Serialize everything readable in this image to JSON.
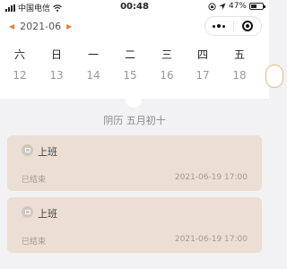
{
  "status_bar": {
    "carrier": "中国电信",
    "time": "00:48",
    "battery_percent": "47%",
    "battery_level": 0.47
  },
  "header": {
    "month": "2021-06",
    "prev_arrow": "◀",
    "next_arrow": "▶"
  },
  "calendar": {
    "weekdays": [
      "六",
      "日",
      "一",
      "二",
      "三",
      "四",
      "五"
    ],
    "days": [
      "12",
      "13",
      "14",
      "15",
      "16",
      "17",
      "18"
    ]
  },
  "lunar_date": "阴历 五月初十",
  "events": [
    {
      "title": "上班",
      "status": "已结束",
      "time": "2021-06-19 17:00"
    },
    {
      "title": "上班",
      "status": "已结束",
      "time": "2021-06-19 17:00"
    }
  ],
  "colors": {
    "accent": "#e2843f",
    "card_bg": "#ebdfd3",
    "page_bg": "#f2f1f3"
  }
}
